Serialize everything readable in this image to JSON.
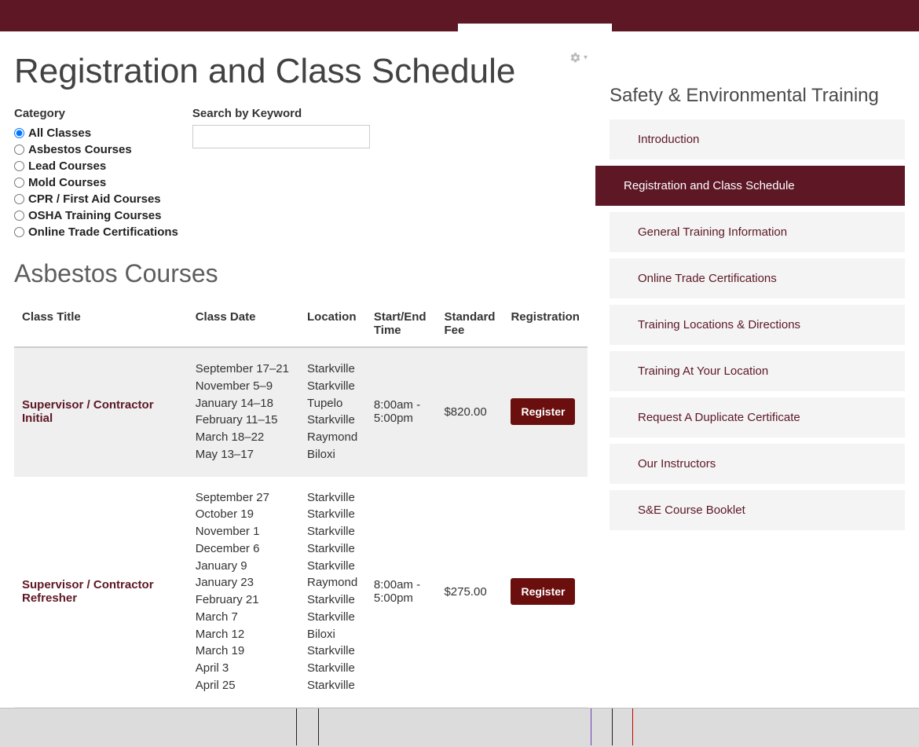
{
  "header": {},
  "page": {
    "title": "Registration and Class Schedule"
  },
  "filters": {
    "category_label": "Category",
    "categories": [
      {
        "label": "All Classes",
        "checked": true
      },
      {
        "label": "Asbestos Courses",
        "checked": false
      },
      {
        "label": "Lead Courses",
        "checked": false
      },
      {
        "label": "Mold Courses",
        "checked": false
      },
      {
        "label": "CPR / First Aid Courses",
        "checked": false
      },
      {
        "label": "OSHA Training Courses",
        "checked": false
      },
      {
        "label": "Online Trade Certifications",
        "checked": false
      }
    ],
    "search_label": "Search by Keyword",
    "search_value": ""
  },
  "section": {
    "title": "Asbestos Courses",
    "columns": [
      "Class Title",
      "Class Date",
      "Location",
      "Start/End Time",
      "Standard Fee",
      "Registration"
    ],
    "rows": [
      {
        "shaded": true,
        "class_title": "Supervisor / Contractor Initial",
        "dates": "September 17–21\nNovember 5–9\nJanuary 14–18\nFebruary 11–15\nMarch 18–22\nMay 13–17",
        "locations": "Starkville\nStarkville\nTupelo\nStarkville\nRaymond\nBiloxi",
        "time": "8:00am - 5:00pm",
        "fee": "$820.00",
        "register_label": "Register"
      },
      {
        "shaded": false,
        "class_title": "Supervisor / Contractor Refresher",
        "dates": "September 27\nOctober 19\nNovember 1\nDecember 6\nJanuary 9\nJanuary 23\nFebruary 21\nMarch 7\nMarch 12\nMarch 19\nApril 3\nApril 25",
        "locations": "Starkville\nStarkville\nStarkville\nStarkville\nStarkville\nRaymond\nStarkville\nStarkville\nBiloxi\nStarkville\nStarkville\nStarkville",
        "time": "8:00am - 5:00pm",
        "fee": "$275.00",
        "register_label": "Register"
      }
    ]
  },
  "sidebar": {
    "title": "Safety & Environmental Training",
    "items": [
      {
        "label": "Introduction",
        "active": false
      },
      {
        "label": "Registration and Class Schedule",
        "active": true
      },
      {
        "label": "General Training Information",
        "active": false
      },
      {
        "label": "Online Trade Certifications",
        "active": false
      },
      {
        "label": "Training Locations & Directions",
        "active": false
      },
      {
        "label": "Training At Your Location",
        "active": false
      },
      {
        "label": "Request A Duplicate Certificate",
        "active": false
      },
      {
        "label": "Our Instructors",
        "active": false
      },
      {
        "label": "S&E Course Booklet",
        "active": false
      }
    ]
  }
}
